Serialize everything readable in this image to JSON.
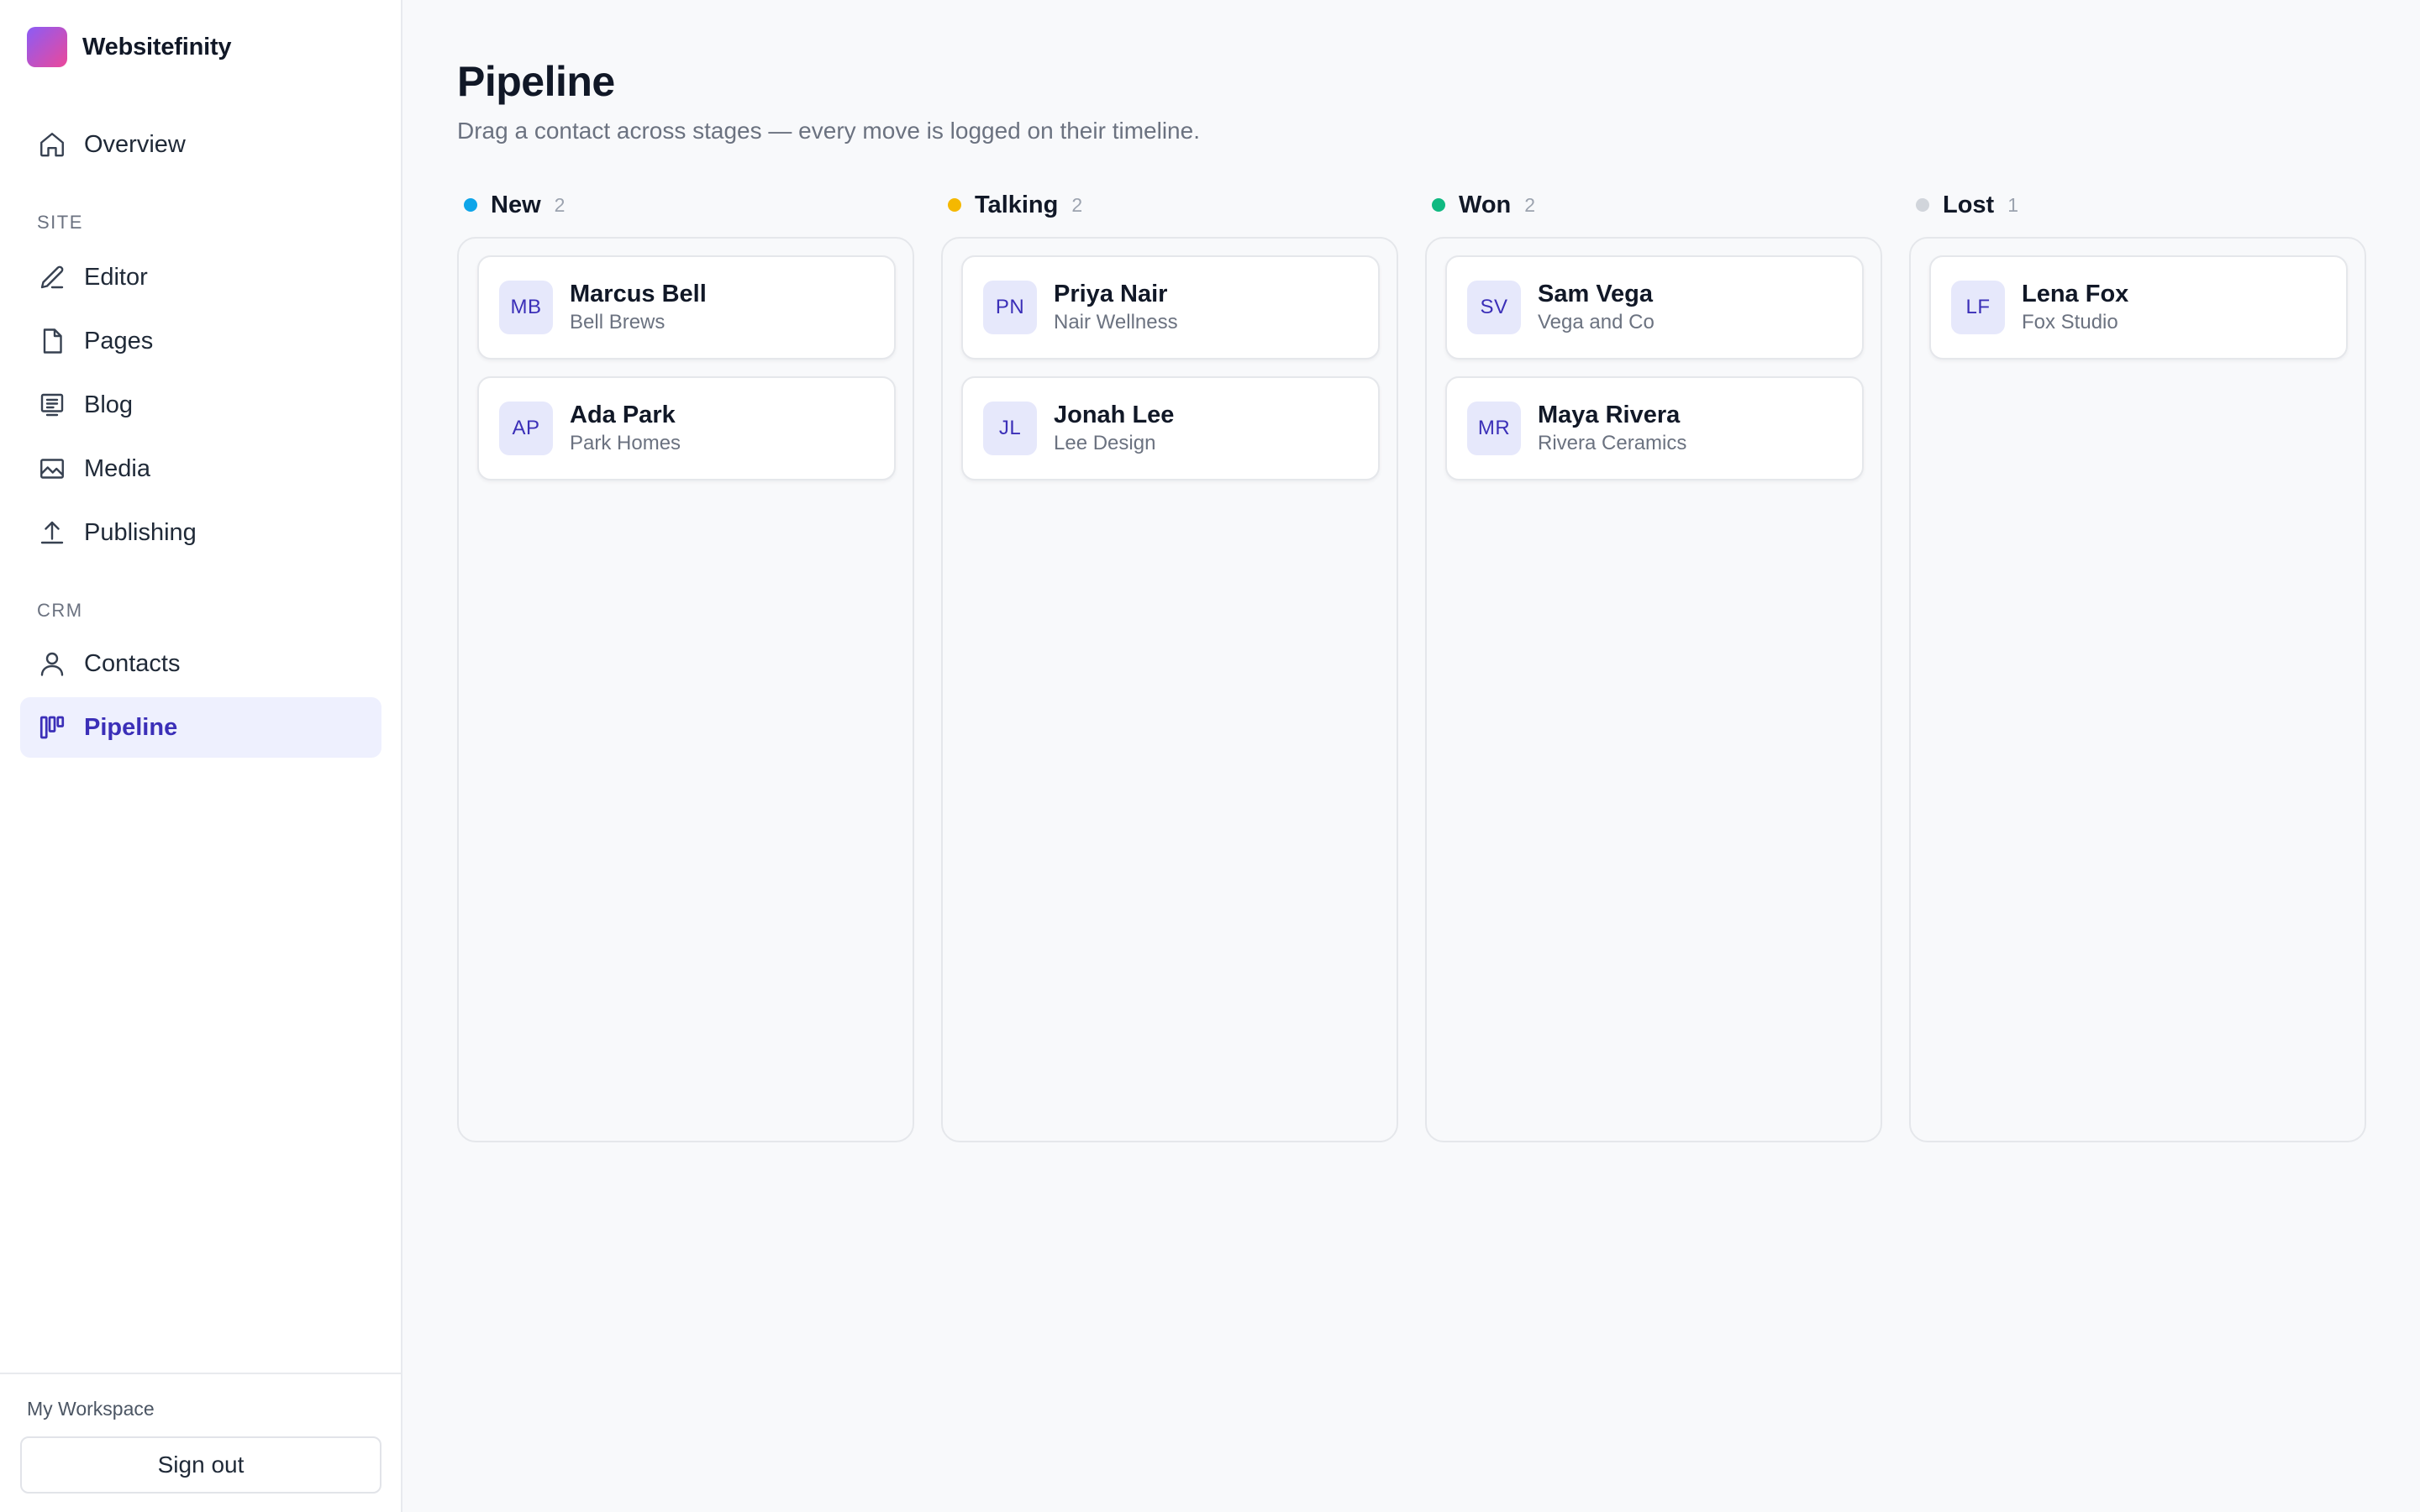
{
  "app": {
    "name": "Websitefinity"
  },
  "sidebar": {
    "overview": {
      "label": "Overview",
      "icon": "home-icon"
    },
    "section_site": "SITE",
    "site_items": [
      {
        "label": "Editor",
        "icon": "pencil-icon"
      },
      {
        "label": "Pages",
        "icon": "file-icon"
      },
      {
        "label": "Blog",
        "icon": "blog-icon"
      },
      {
        "label": "Media",
        "icon": "image-icon"
      },
      {
        "label": "Publishing",
        "icon": "upload-icon"
      }
    ],
    "section_crm": "CRM",
    "crm_items": [
      {
        "label": "Contacts",
        "icon": "user-icon"
      },
      {
        "label": "Pipeline",
        "icon": "kanban-icon",
        "active": true
      }
    ],
    "workspace": "My Workspace",
    "signout": "Sign out"
  },
  "page": {
    "title": "Pipeline",
    "subtitle": "Drag a contact across stages — every move is logged on their timeline."
  },
  "colors": {
    "accent": "#3b2fb8",
    "new": "#0ea5e9",
    "talking": "#f5b800",
    "won": "#10b981",
    "lost": "#d1d5db"
  },
  "columns": [
    {
      "title": "New",
      "count": "2",
      "color": "#0ea5e9",
      "cards": [
        {
          "initials": "MB",
          "name": "Marcus Bell",
          "company": "Bell Brews"
        },
        {
          "initials": "AP",
          "name": "Ada Park",
          "company": "Park Homes"
        }
      ]
    },
    {
      "title": "Talking",
      "count": "2",
      "color": "#f5b800",
      "cards": [
        {
          "initials": "PN",
          "name": "Priya Nair",
          "company": "Nair Wellness"
        },
        {
          "initials": "JL",
          "name": "Jonah Lee",
          "company": "Lee Design"
        }
      ]
    },
    {
      "title": "Won",
      "count": "2",
      "color": "#10b981",
      "cards": [
        {
          "initials": "SV",
          "name": "Sam Vega",
          "company": "Vega and Co"
        },
        {
          "initials": "MR",
          "name": "Maya Rivera",
          "company": "Rivera Ceramics"
        }
      ]
    },
    {
      "title": "Lost",
      "count": "1",
      "color": "#d1d5db",
      "cards": [
        {
          "initials": "LF",
          "name": "Lena Fox",
          "company": "Fox Studio"
        }
      ]
    }
  ]
}
